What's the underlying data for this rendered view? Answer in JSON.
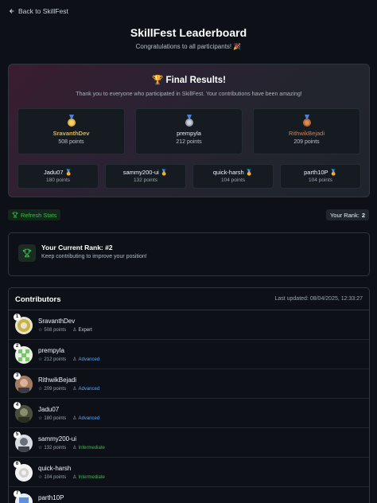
{
  "nav": {
    "back_label": "Back to SkillFest"
  },
  "header": {
    "title": "SkillFest Leaderboard",
    "subtitle": "Congratulations to all participants! 🎉"
  },
  "final_results": {
    "title": "🏆 Final Results!",
    "subtitle": "Thank you to everyone who participated in SkillFest. Your contributions have been amazing!",
    "top3": [
      {
        "name": "SravanthDev",
        "points": "508 points",
        "medal": "gold-medal-icon",
        "color": "#e3b341"
      },
      {
        "name": "prempyla",
        "points": "212 points",
        "medal": "silver-medal-icon",
        "color": "#f0f6fc"
      },
      {
        "name": "RithwikBejadi",
        "points": "209 points",
        "medal": "bronze-medal-icon",
        "color": "#d2804a"
      }
    ],
    "runners": [
      {
        "name": "Jadu07",
        "points": "180 points"
      },
      {
        "name": "sammy200-ui",
        "points": "132 points"
      },
      {
        "name": "quick-harsh",
        "points": "104 points"
      },
      {
        "name": "parth10P",
        "points": "104 points"
      }
    ],
    "runner_badge": "🏅"
  },
  "controls": {
    "refresh_label": "Refresh Stats",
    "rank_label": "Your Rank:",
    "rank_value": "2"
  },
  "current_rank": {
    "title": "Your Current Rank: #2",
    "subtitle": "Keep contributing to improve your position!"
  },
  "contributors": {
    "title": "Contributors",
    "last_updated": "Last updated: 08/04/2025, 12:33:27",
    "rows": [
      {
        "rank": "1",
        "name": "SravanthDev",
        "points": "508 points",
        "level": "Expert"
      },
      {
        "rank": "2",
        "name": "prempyla",
        "points": "212 points",
        "level": "Advanced"
      },
      {
        "rank": "3",
        "name": "RithwikBejadi",
        "points": "209 points",
        "level": "Advanced"
      },
      {
        "rank": "4",
        "name": "Jadu07",
        "points": "180 points",
        "level": "Advanced"
      },
      {
        "rank": "5",
        "name": "sammy200-ui",
        "points": "132 points",
        "level": "Intermediate"
      },
      {
        "rank": "6",
        "name": "quick-harsh",
        "points": "104 points",
        "level": "Intermediate"
      },
      {
        "rank": "7",
        "name": "parth10P",
        "points": "",
        "level": ""
      }
    ]
  },
  "colors": {
    "background": "#0d1117",
    "accent_green": "#3fb950",
    "advanced_blue": "#58a6ff",
    "gold": "#e3b341",
    "bronze": "#d2804a"
  }
}
